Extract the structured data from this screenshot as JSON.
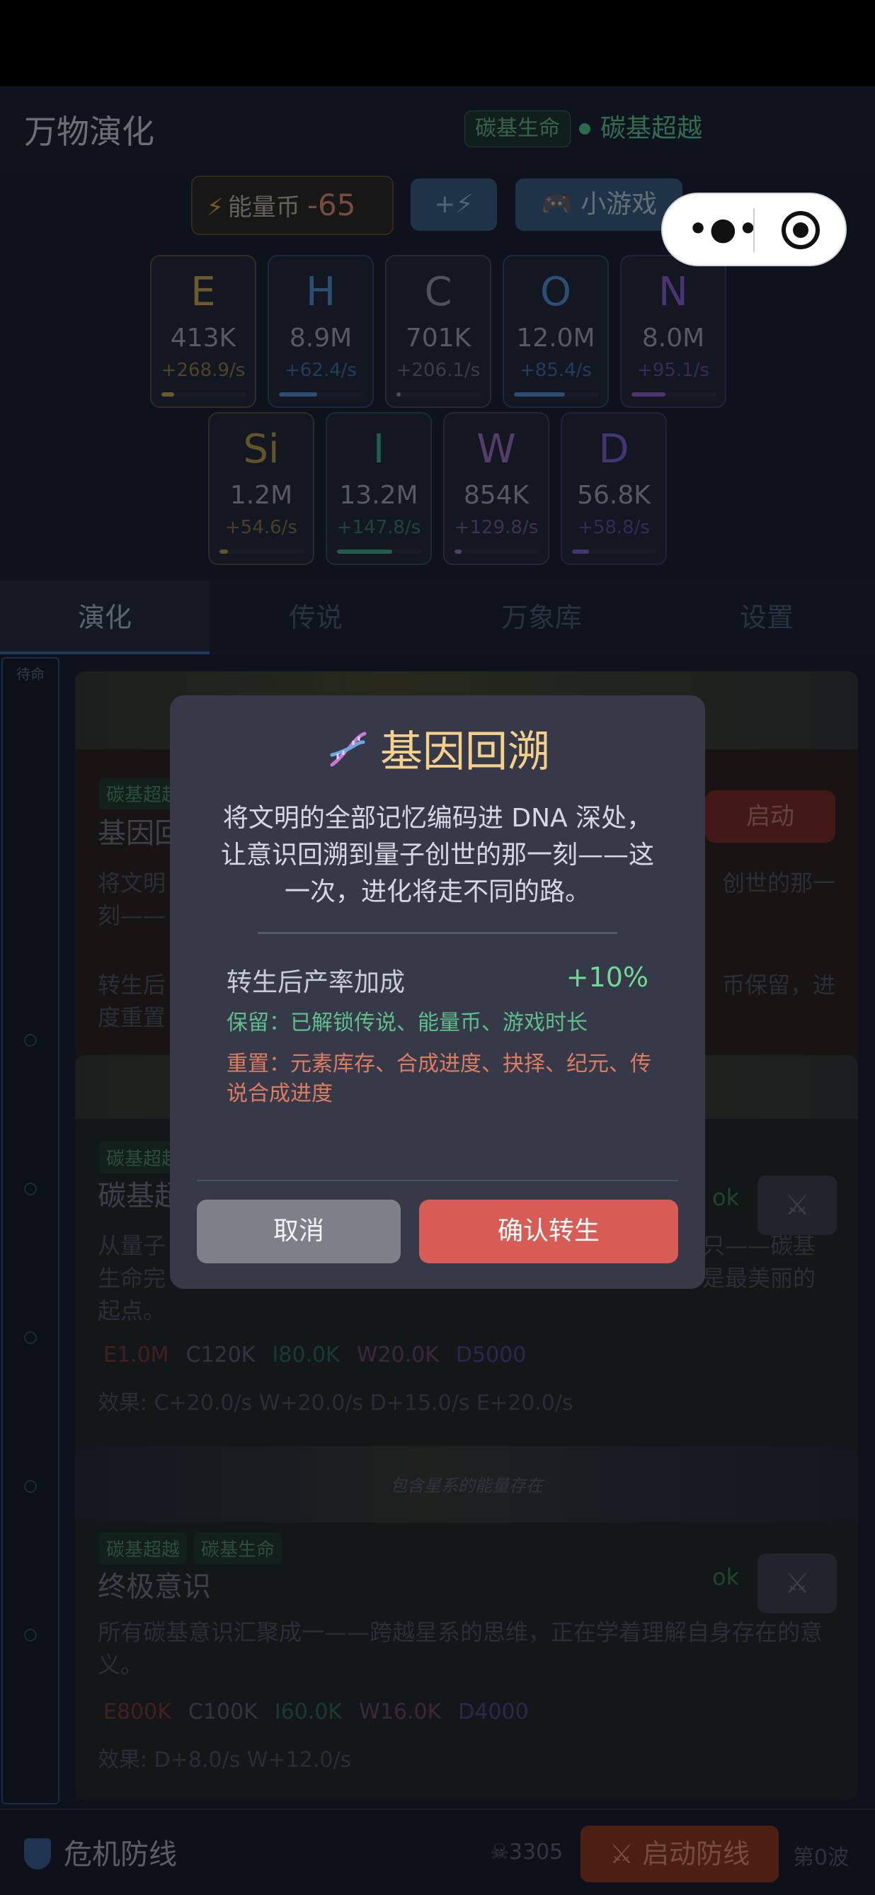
{
  "header": {
    "app_title": "万物演化",
    "era_chip": "碳基生命",
    "current_era": "碳基超越"
  },
  "energy": {
    "icon": "bolt-icon",
    "label": "能量币",
    "value": "-65",
    "charge_label": "+⚡",
    "game_label": "🎮 小游戏"
  },
  "elements": [
    {
      "symbol": "E",
      "amount": "413K",
      "rate": "+268.9/s",
      "color": "#c9a24a",
      "fill": 0.15
    },
    {
      "symbol": "H",
      "amount": "8.9M",
      "rate": "+62.4/s",
      "color": "#4f8fd0",
      "fill": 0.45
    },
    {
      "symbol": "C",
      "amount": "701K",
      "rate": "+206.1/s",
      "color": "#8a93a6",
      "fill": 0.05
    },
    {
      "symbol": "O",
      "amount": "12.0M",
      "rate": "+85.4/s",
      "color": "#4f8fd0",
      "fill": 0.6
    },
    {
      "symbol": "N",
      "amount": "8.0M",
      "rate": "+95.1/s",
      "color": "#8a5fd0",
      "fill": 0.4
    },
    {
      "symbol": "Si",
      "amount": "1.2M",
      "rate": "+54.6/s",
      "color": "#b59a4a",
      "fill": 0.1
    },
    {
      "symbol": "I",
      "amount": "13.2M",
      "rate": "+147.8/s",
      "color": "#3fa88a",
      "fill": 0.65
    },
    {
      "symbol": "W",
      "amount": "854K",
      "rate": "+129.8/s",
      "color": "#9a6fc0",
      "fill": 0.08
    },
    {
      "symbol": "D",
      "amount": "56.8K",
      "rate": "+58.8/s",
      "color": "#7a5fd0",
      "fill": 0.2
    }
  ],
  "tabs": [
    {
      "label": "演化",
      "active": true
    },
    {
      "label": "传说",
      "active": false
    },
    {
      "label": "万象库",
      "active": false
    },
    {
      "label": "设置",
      "active": false
    }
  ],
  "sidebar": {
    "label": "待命"
  },
  "cards": [
    {
      "tag": "碳基超越",
      "title": "基因回溯",
      "desc_left": "将文明",
      "desc_right": "创世的那一",
      "desc_left2": "刻——",
      "desc_left3": "转生后",
      "desc_right3": "币保留，进",
      "desc_left4": "度重置",
      "button": "启动"
    },
    {
      "tag": "碳基超越",
      "title": "碳基超",
      "desc": "从量子",
      "desc_right": "只——碳基",
      "desc_line2_left": "生命完",
      "desc_line2_right": "是最美丽的",
      "desc_line3": "起点。",
      "costs": [
        {
          "text": "E1.0M",
          "color": "#7a3a3a"
        },
        {
          "text": "C120K",
          "color": "#5a6070"
        },
        {
          "text": "I80.0K",
          "color": "#2f6a5a"
        },
        {
          "text": "W20.0K",
          "color": "#6a4a6a"
        },
        {
          "text": "D5000",
          "color": "#4a4a8a"
        }
      ],
      "effect": "效果: C+20.0/s  W+20.0/s  D+15.0/s  E+20.0/s",
      "ok": "ok"
    },
    {
      "tags": [
        "碳基超越",
        "碳基生命"
      ],
      "title": "终极意识",
      "desc": "所有碳基意识汇聚成一——跨越星系的思维，正在学着理解自身存在的意义。",
      "banner_text": "包含星系的能量存在",
      "costs": [
        {
          "text": "E800K",
          "color": "#7a3a3a"
        },
        {
          "text": "C100K",
          "color": "#5a6070"
        },
        {
          "text": "I60.0K",
          "color": "#2f6a5a"
        },
        {
          "text": "W16.0K",
          "color": "#6a4a6a"
        },
        {
          "text": "D4000",
          "color": "#4a4a8a"
        }
      ],
      "effect": "效果: D+8.0/s  W+12.0/s",
      "ok": "ok"
    }
  ],
  "bottom": {
    "title": "危机防线",
    "threat": "☠3305",
    "defense_button": "⚔ 启动防线",
    "wave": "第0波"
  },
  "modal": {
    "title": "基因回溯",
    "icon": "dna-icon",
    "desc": "将文明的全部记忆编码进 DNA 深处，让意识回溯到量子创世的那一刻——这一次，进化将走不同的路。",
    "bonus_label": "转生后产率加成",
    "bonus_value": "+10%",
    "keep": "保留：已解锁传说、能量币、游戏时长",
    "reset": "重置：元素库存、合成进度、抉择、纪元、传说合成进度",
    "cancel": "取消",
    "confirm": "确认转生"
  }
}
